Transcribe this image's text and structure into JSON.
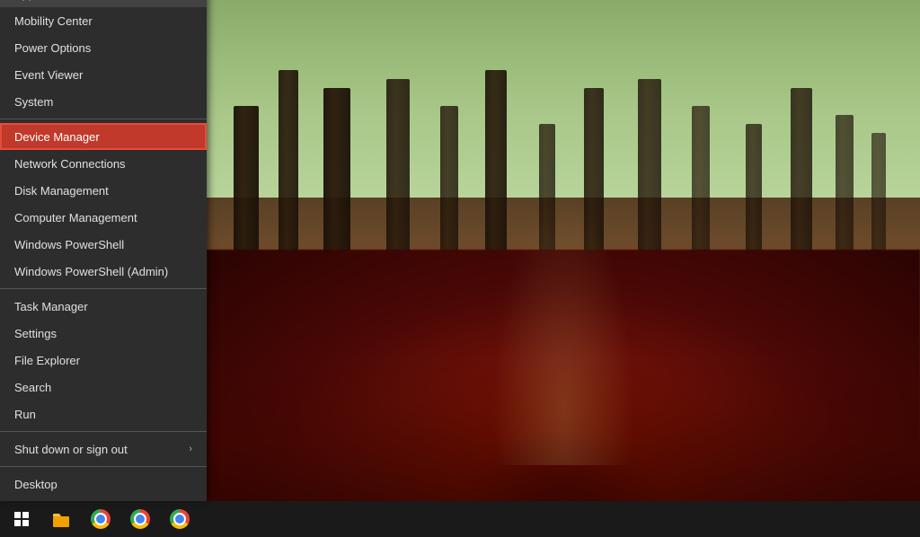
{
  "desktop": {
    "title": "Desktop"
  },
  "contextMenu": {
    "items": [
      {
        "id": "apps-features",
        "label": "Apps and Features",
        "highlighted": false,
        "hasSub": false
      },
      {
        "id": "mobility-center",
        "label": "Mobility Center",
        "highlighted": false,
        "hasSub": false
      },
      {
        "id": "power-options",
        "label": "Power Options",
        "highlighted": false,
        "hasSub": false
      },
      {
        "id": "event-viewer",
        "label": "Event Viewer",
        "highlighted": false,
        "hasSub": false
      },
      {
        "id": "system",
        "label": "System",
        "highlighted": false,
        "hasSub": false
      },
      {
        "id": "device-manager",
        "label": "Device Manager",
        "highlighted": true,
        "hasSub": false
      },
      {
        "id": "network-connections",
        "label": "Network Connections",
        "highlighted": false,
        "hasSub": false
      },
      {
        "id": "disk-management",
        "label": "Disk Management",
        "highlighted": false,
        "hasSub": false
      },
      {
        "id": "computer-management",
        "label": "Computer Management",
        "highlighted": false,
        "hasSub": false
      },
      {
        "id": "windows-powershell",
        "label": "Windows PowerShell",
        "highlighted": false,
        "hasSub": false
      },
      {
        "id": "windows-powershell-admin",
        "label": "Windows PowerShell (Admin)",
        "highlighted": false,
        "hasSub": false
      },
      {
        "id": "task-manager",
        "label": "Task Manager",
        "highlighted": false,
        "hasSub": false
      },
      {
        "id": "settings",
        "label": "Settings",
        "highlighted": false,
        "hasSub": false
      },
      {
        "id": "file-explorer",
        "label": "File Explorer",
        "highlighted": false,
        "hasSub": false
      },
      {
        "id": "search",
        "label": "Search",
        "highlighted": false,
        "hasSub": false
      },
      {
        "id": "run",
        "label": "Run",
        "highlighted": false,
        "hasSub": false
      },
      {
        "id": "shut-down-or-sign-out",
        "label": "Shut down or sign out",
        "highlighted": false,
        "hasSub": true
      },
      {
        "id": "desktop",
        "label": "Desktop",
        "highlighted": false,
        "hasSub": false
      }
    ],
    "separatorAfter": [
      4,
      10,
      15,
      16
    ]
  },
  "taskbar": {
    "startLabel": "⊞",
    "icons": [
      {
        "id": "file-explorer",
        "title": "File Explorer"
      },
      {
        "id": "chrome1",
        "title": "Google Chrome"
      },
      {
        "id": "chrome2",
        "title": "Google Chrome"
      },
      {
        "id": "chrome3",
        "title": "Google Chrome"
      }
    ]
  },
  "colors": {
    "menuBg": "#2d2d2d",
    "menuText": "#e0e0e0",
    "highlighted": "#c0392b",
    "separator": "#555555",
    "taskbar": "#1a1a1a"
  }
}
